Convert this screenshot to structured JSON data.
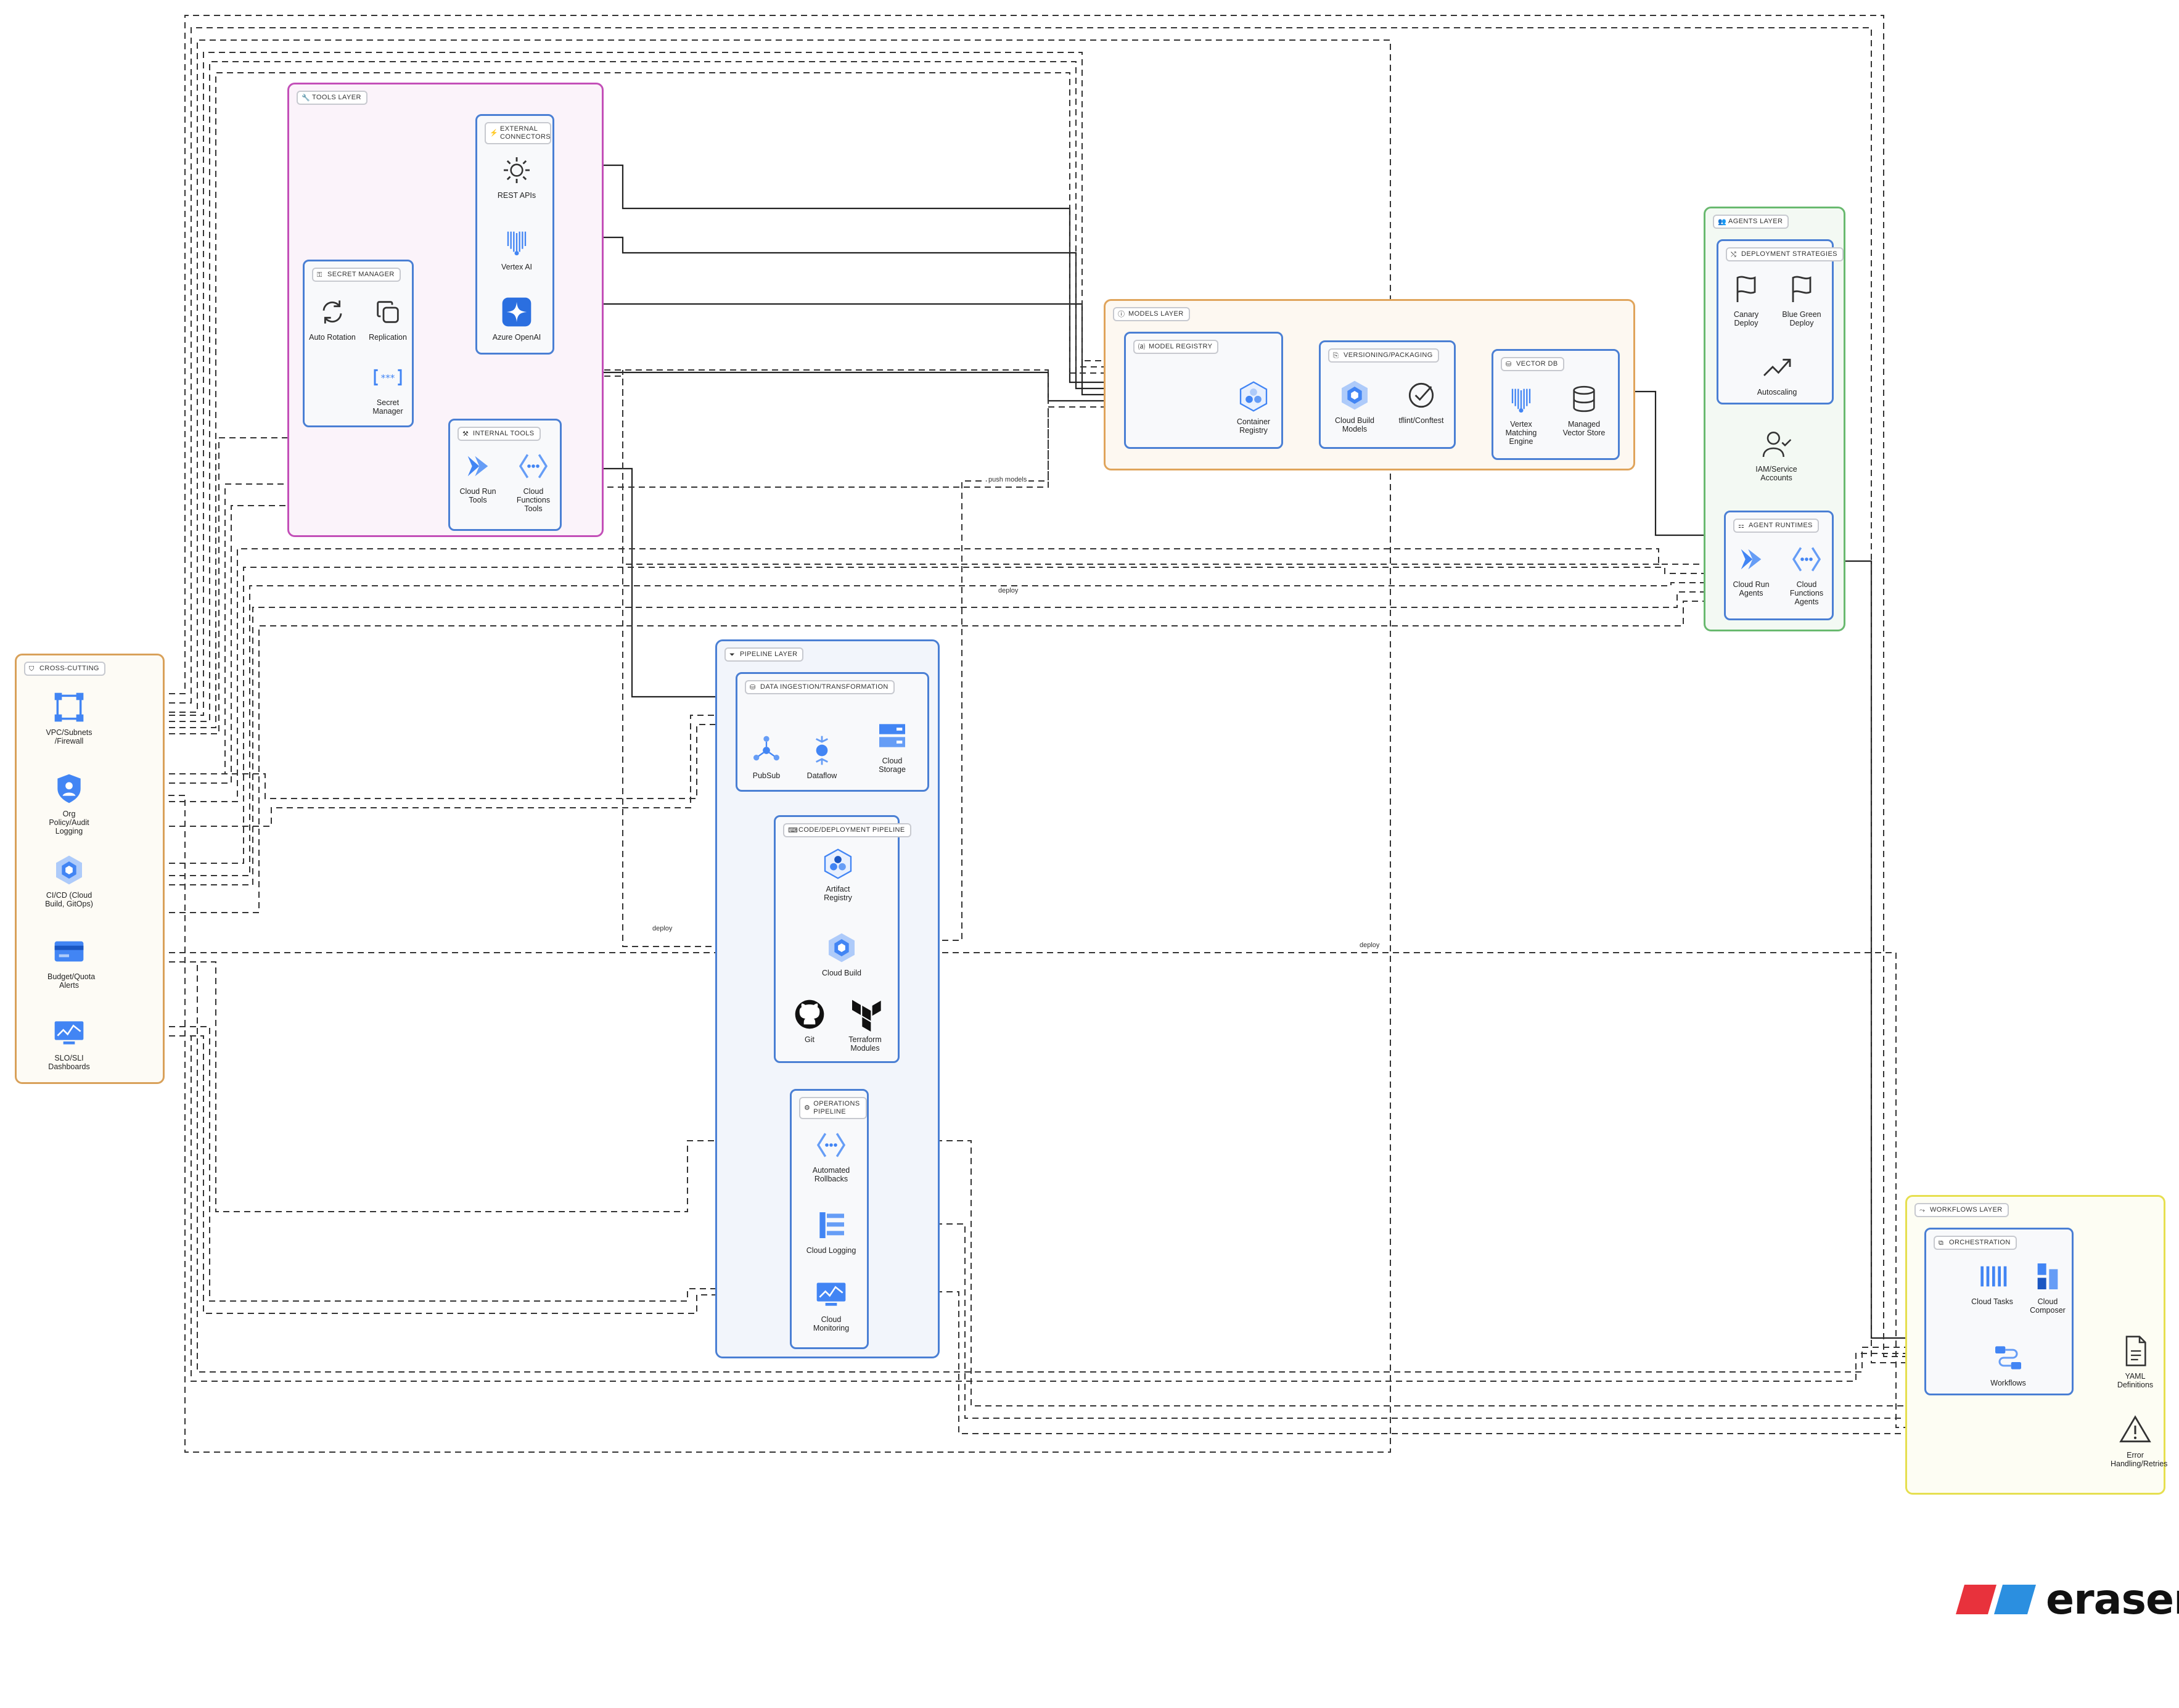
{
  "colors": {
    "tools": "#c34fb8",
    "tools_bg": "#fbf3fa",
    "models": "#e0a45b",
    "models_bg": "#fdf8f1",
    "agents": "#69b96f",
    "agents_bg": "#f3f9f3",
    "crosscutting": "#d9a15a",
    "crosscutting_bg": "#fdfbf5",
    "pipeline": "#4a7fd4",
    "pipeline_bg": "#f2f5fb",
    "workflows": "#e6df4f",
    "workflows_bg": "#fdfdf3",
    "sub": "#4a7fd4",
    "brand_red": "#e8323c",
    "brand_blue": "#2b8fe0"
  },
  "layers": {
    "tools": "TOOLS LAYER",
    "external_connectors": "EXTERNAL CONNECTORS",
    "secret_manager": "SECRET MANAGER",
    "internal_tools": "INTERNAL TOOLS",
    "models": "MODELS LAYER",
    "model_registry": "MODEL REGISTRY",
    "versioning": "VERSIONING/PACKAGING",
    "vector_db": "VECTOR DB",
    "agents": "AGENTS LAYER",
    "deployment_strategies": "DEPLOYMENT STRATEGIES",
    "agent_runtimes": "AGENT RUNTIMES",
    "crosscutting": "CROSS-CUTTING",
    "pipeline": "PIPELINE LAYER",
    "data_ingestion": "DATA INGESTION/TRANSFORMATION",
    "code_pipeline": "CODE/DEPLOYMENT PIPELINE",
    "ops_pipeline": "OPERATIONS PIPELINE",
    "workflows": "WORKFLOWS LAYER",
    "orchestration": "ORCHESTRATION"
  },
  "nodes": {
    "rest_apis": "REST APIs",
    "vertex_ai": "Vertex AI",
    "azure_openai": "Azure OpenAI",
    "auto_rotation": "Auto Rotation",
    "replication": "Replication",
    "secret_manager": "Secret Manager",
    "cloud_run_tools": "Cloud Run Tools",
    "cloud_functions_tools": "Cloud Functions Tools",
    "container_registry": "Container Registry",
    "cloud_build_models": "Cloud Build Models",
    "tflint_conftest": "tflint/Conftest",
    "vertex_matching_engine": "Vertex Matching Engine",
    "managed_vector_store": "Managed Vector Store",
    "canary_deploy": "Canary Deploy",
    "blue_green_deploy": "Blue Green Deploy",
    "autoscaling": "Autoscaling",
    "iam_service_accounts": "IAM/Service Accounts",
    "cloud_run_agents": "Cloud Run Agents",
    "cloud_functions_agents": "Cloud Functions Agents",
    "vpc": "VPC/Subnets /Firewall",
    "org_policy": "Org Policy/Audit Logging",
    "cicd": "CI/CD (Cloud Build, GitOps)",
    "budget": "Budget/Quota Alerts",
    "slo": "SLO/SLI Dashboards",
    "pubsub": "PubSub",
    "dataflow": "Dataflow",
    "cloud_storage": "Cloud Storage",
    "artifact_registry": "Artifact Registry",
    "cloud_build": "Cloud Build",
    "git": "Git",
    "terraform_modules": "Terraform Modules",
    "automated_rollbacks": "Automated Rollbacks",
    "cloud_logging": "Cloud Logging",
    "cloud_monitoring": "Cloud Monitoring",
    "cloud_tasks": "Cloud Tasks",
    "cloud_composer": "Cloud Composer",
    "workflows": "Workflows",
    "yaml_definitions": "YAML Definitions",
    "error_handling": "Error Handling/Retries"
  },
  "edge_labels": {
    "push_models": "push models",
    "deploy": "deploy"
  },
  "icons": {
    "rest_apis": "gear-icon",
    "vertex_ai": "vertex-ai-icon",
    "azure_openai": "azure-openai-icon",
    "auto_rotation": "rotate-icon",
    "replication": "copy-icon",
    "secret_manager": "secret-manager-icon",
    "cloud_run": "cloud-run-icon",
    "cloud_functions": "cloud-functions-icon",
    "container_registry": "container-registry-icon",
    "cloud_build": "cloud-build-icon",
    "tflint": "check-circle-icon",
    "vertex_matching": "vertex-ai-icon",
    "vector_store": "database-icon",
    "canary": "flag-icon",
    "blue_green": "flag-icon",
    "autoscaling": "trending-up-icon",
    "iam": "user-check-icon",
    "vpc": "vpc-icon",
    "org_policy": "shield-icon",
    "budget": "billing-icon",
    "slo": "monitoring-icon",
    "pubsub": "pubsub-icon",
    "dataflow": "dataflow-icon",
    "cloud_storage": "cloud-storage-icon",
    "artifact_registry": "artifact-registry-icon",
    "git": "github-icon",
    "terraform": "terraform-icon",
    "logging": "cloud-logging-icon",
    "monitoring": "cloud-monitoring-icon",
    "cloud_tasks": "cloud-tasks-icon",
    "cloud_composer": "cloud-composer-icon",
    "workflows": "workflows-icon",
    "yaml": "file-icon",
    "error": "warning-icon"
  },
  "brand": {
    "name": "eraser"
  }
}
